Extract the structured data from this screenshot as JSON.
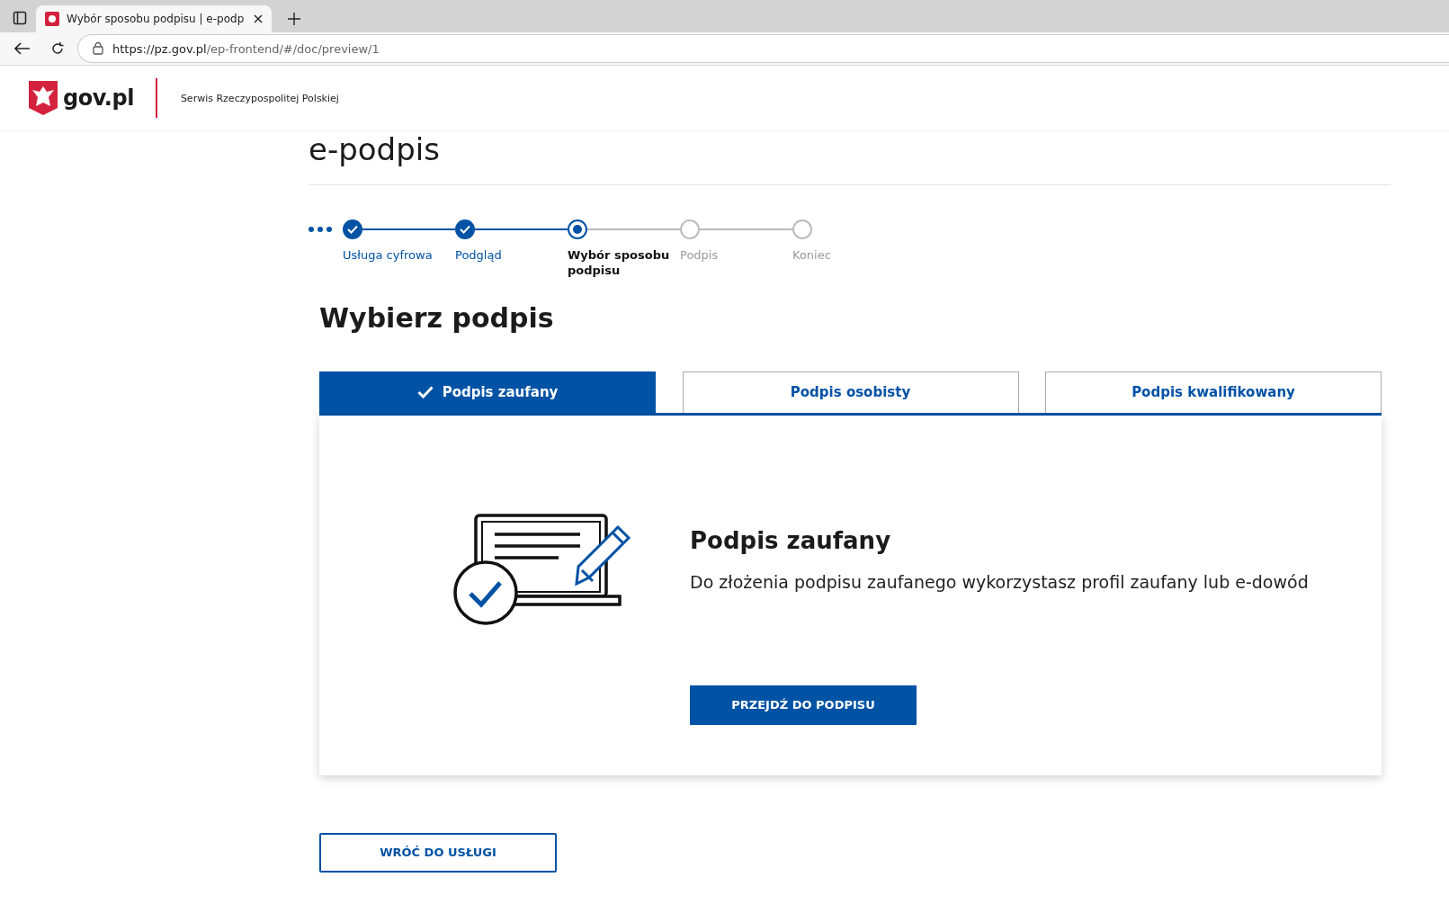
{
  "browser": {
    "tab_title": "Wybór sposobu podpisu | e-podp",
    "url_host": "https://pz.gov.pl",
    "url_path": "/ep-frontend/#/doc/preview/1"
  },
  "header": {
    "logo": "gov.pl",
    "tagline": "Serwis Rzeczypospolitej Polskiej"
  },
  "page_title": "e-podpis",
  "steps": [
    {
      "label": "Usługa cyfrowa",
      "completed": true,
      "selected": false
    },
    {
      "label": "Podgląd",
      "completed": true,
      "selected": false
    },
    {
      "label": "Wybór sposobu podpisu",
      "completed": false,
      "selected": true
    },
    {
      "label": "Podpis",
      "completed": false,
      "selected": false
    },
    {
      "label": "Koniec",
      "completed": false,
      "selected": false
    }
  ],
  "heading": "Wybierz podpis",
  "tabs": [
    {
      "label": "Podpis zaufany",
      "selected": true
    },
    {
      "label": "Podpis osobisty",
      "selected": false
    },
    {
      "label": "Podpis kwalifikowany",
      "selected": false
    }
  ],
  "panel": {
    "title": "Podpis zaufany",
    "description": "Do złożenia podpisu zaufanego wykorzystasz profil zaufany lub e-dowód",
    "button": "PRZEJDŹ DO PODPISU"
  },
  "back_button": "WRÓĆ DO USŁUGI"
}
